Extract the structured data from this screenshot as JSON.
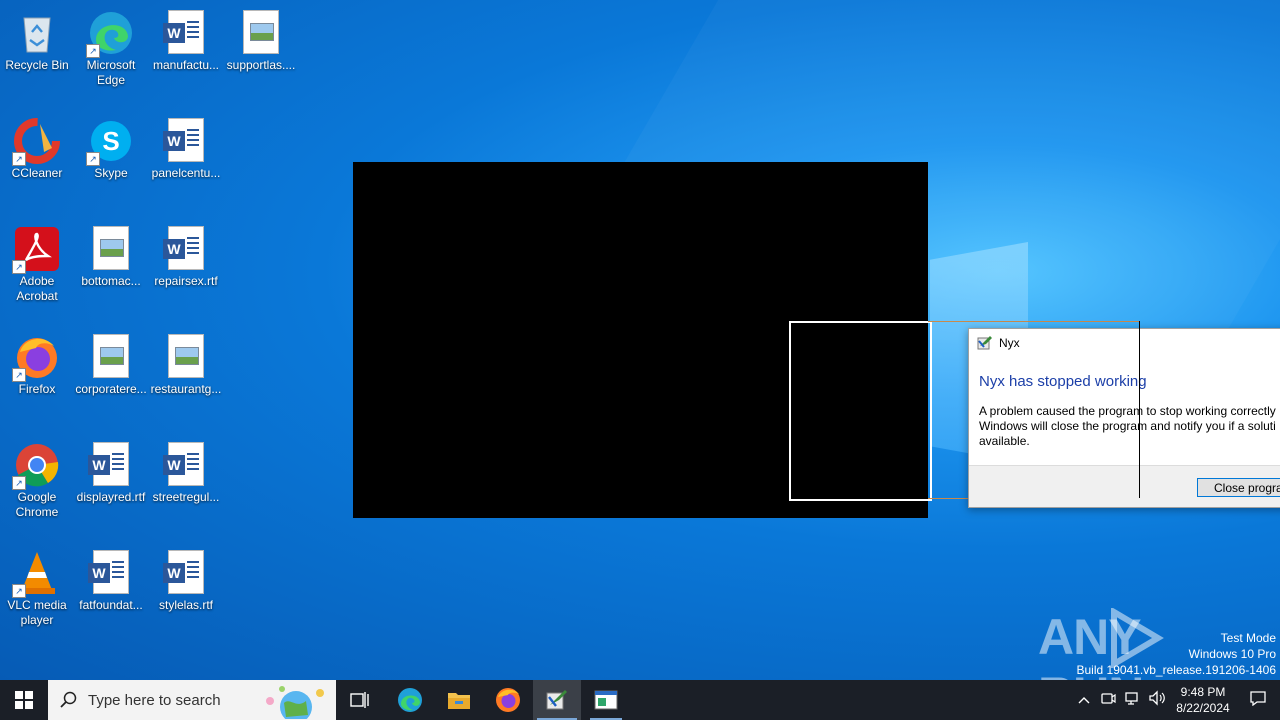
{
  "desktop": {
    "icons": [
      {
        "label": "Recycle Bin",
        "icon": "recycle-bin-icon"
      },
      {
        "label": "Microsoft Edge",
        "icon": "edge-icon"
      },
      {
        "label": "manufactu...",
        "icon": "word-document-icon"
      },
      {
        "label": "supportlas....",
        "icon": "image-document-icon"
      },
      {
        "label": "CCleaner",
        "icon": "ccleaner-icon"
      },
      {
        "label": "Skype",
        "icon": "skype-icon"
      },
      {
        "label": "panelcentu...",
        "icon": "word-document-icon"
      },
      {
        "label": "Adobe Acrobat",
        "icon": "acrobat-icon"
      },
      {
        "label": "bottomac...",
        "icon": "image-document-icon"
      },
      {
        "label": "repairsex.rtf",
        "icon": "word-document-icon"
      },
      {
        "label": "Firefox",
        "icon": "firefox-icon"
      },
      {
        "label": "corporatere...",
        "icon": "image-document-icon"
      },
      {
        "label": "restaurantg...",
        "icon": "image-document-icon"
      },
      {
        "label": "Google Chrome",
        "icon": "chrome-icon"
      },
      {
        "label": "displayred.rtf",
        "icon": "word-document-icon"
      },
      {
        "label": "streetregul...",
        "icon": "word-document-icon"
      },
      {
        "label": "VLC media player",
        "icon": "vlc-icon"
      },
      {
        "label": "fatfoundat...",
        "icon": "word-document-icon"
      },
      {
        "label": "stylelas.rtf",
        "icon": "word-document-icon"
      }
    ]
  },
  "dialog": {
    "title": "Nyx",
    "heading": "Nyx has stopped working",
    "message_line1": "A problem caused the program to stop working correctly",
    "message_line2": "Windows will close the program and notify you if a soluti",
    "message_line3": "available.",
    "close_button": "Close progra"
  },
  "watermark": {
    "brand_left": "ANY",
    "brand_right": "RUN",
    "line1": "Test Mode",
    "line2": "Windows 10 Pro",
    "line3": "Build 19041.vb_release.191206-1406"
  },
  "taskbar": {
    "search_placeholder": "Type here to search",
    "clock_time": "9:48 PM",
    "clock_date": "8/22/2024"
  },
  "colors": {
    "accent": "#0078d7",
    "dialog_heading": "#1c3fa8",
    "taskbar": "#1b1f27"
  }
}
